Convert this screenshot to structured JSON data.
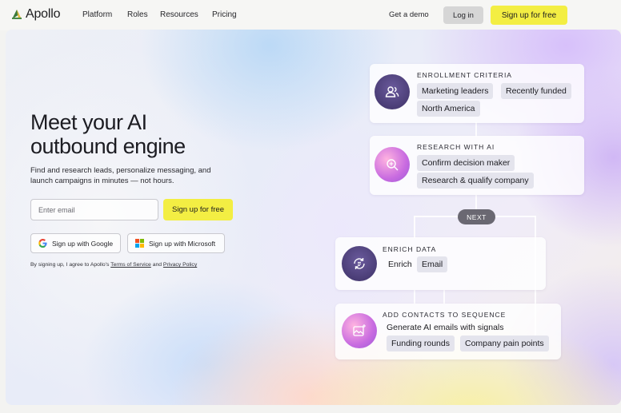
{
  "nav": {
    "logo_text": "Apollo",
    "links": [
      "Platform",
      "Roles",
      "Resources",
      "Pricing"
    ],
    "demo_label": "Get a demo",
    "login_label": "Log in",
    "signup_label": "Sign up for free"
  },
  "hero": {
    "headline_line1": "Meet your AI",
    "headline_line2": "outbound engine",
    "subtext": "Find and research leads, personalize messaging, and launch campaigns in minutes — not hours.",
    "email_placeholder": "Enter email",
    "signup_label": "Sign up for free",
    "google_label": "Sign up with Google",
    "microsoft_label": "Sign up with Microsoft",
    "terms_prefix": "By signing up, I agree to Apollo's",
    "terms_link": "Terms of Service",
    "terms_and": "and",
    "privacy_link": "Privacy Policy"
  },
  "workflow": {
    "enrollment": {
      "title": "ENROLLMENT CRITERIA",
      "chips": [
        "Marketing leaders",
        "Recently funded",
        "North America"
      ],
      "icon": "people-icon"
    },
    "research": {
      "title": "RESEARCH WITH AI",
      "chips": [
        "Confirm decision maker",
        "Research & qualify company"
      ],
      "icon": "sparkle-search-icon"
    },
    "next_label": "NEXT",
    "enrich": {
      "title": "ENRICH DATA",
      "label": "Enrich",
      "chips": [
        "Email"
      ],
      "icon": "refresh-list-icon"
    },
    "sequence": {
      "title": "ADD CONTACTS TO SEQUENCE",
      "label": "Generate AI emails with signals",
      "chips": [
        "Funding rounds",
        "Company pain points"
      ],
      "icon": "ai-image-icon"
    }
  },
  "colors": {
    "brand_yellow": "#f3ee43",
    "icon_purple": "#4d3f7a"
  }
}
